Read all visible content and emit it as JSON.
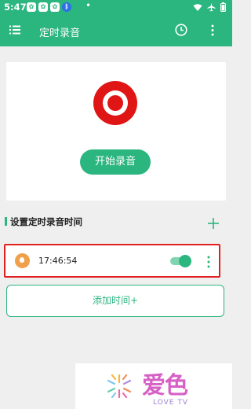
{
  "status_bar": {
    "time": "5:47",
    "icons": [
      "paw-icon",
      "paw-icon",
      "paw-icon",
      "bluetooth-icon",
      "dot-icon",
      "wifi-icon",
      "airplane-icon",
      "battery-icon"
    ]
  },
  "toolbar": {
    "title": "定时录音",
    "left_icon": "menu-icon",
    "right_icons": [
      "clock-icon",
      "more-vert-icon"
    ]
  },
  "record": {
    "button_label": "开始录音",
    "icon": "record-icon"
  },
  "schedule": {
    "title": "设置定时录音时间",
    "add_icon": "plus-icon",
    "items": [
      {
        "time": "17:46:54",
        "enabled": true,
        "badge_icon": "flame-icon"
      }
    ],
    "add_button_label": "添加时间+"
  },
  "watermark": {
    "brand": "爱色",
    "sub": "LOVE TV"
  },
  "colors": {
    "primary": "#2bb57f",
    "record_red": "#e01515",
    "highlight_border": "#e12020",
    "badge_orange": "#f0a04a"
  }
}
